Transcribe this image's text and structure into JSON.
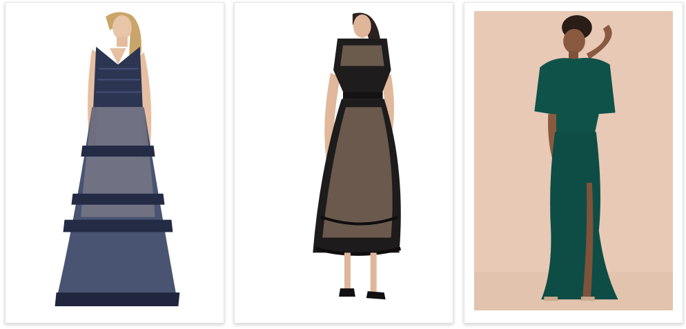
{
  "gallery": {
    "items": [
      {
        "id": "dress-1",
        "icon": "navy-lace-tiered-gown-photo",
        "background": "#ffffff",
        "dress_color": "#2a3350"
      },
      {
        "id": "dress-2",
        "icon": "black-lace-midi-dress-photo",
        "background": "#ffffff",
        "dress_color": "#1d1b1c"
      },
      {
        "id": "dress-3",
        "icon": "emerald-flutter-sleeve-gown-photo",
        "background": "#e7c9b6",
        "dress_color": "#0d4d45"
      }
    ]
  }
}
